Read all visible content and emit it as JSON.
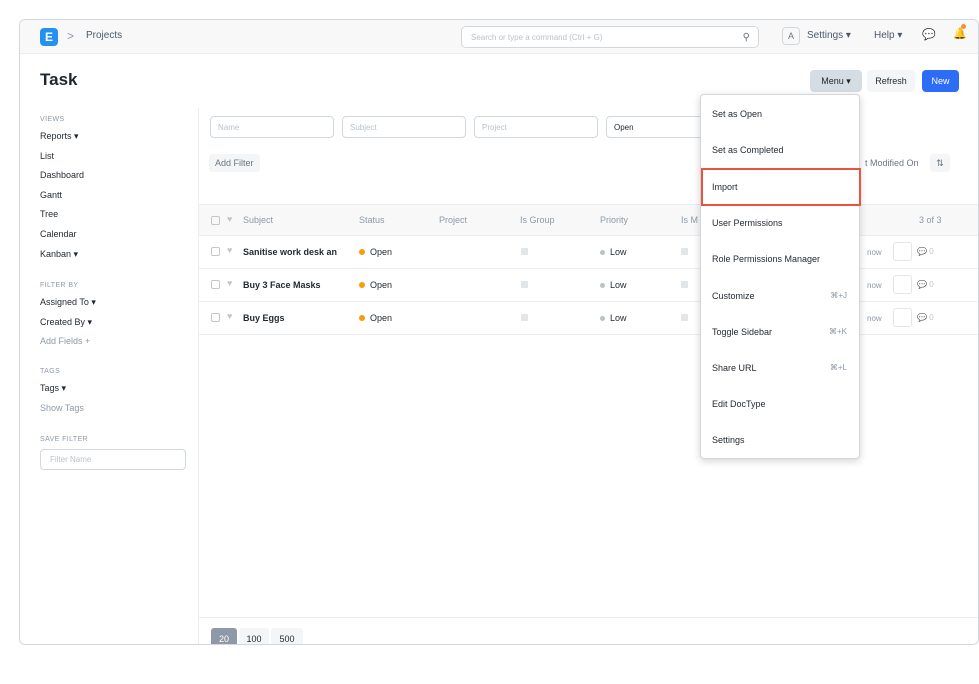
{
  "navbar": {
    "logo_letter": "E",
    "breadcrumb": "Projects",
    "breadcrumb_sep": ">",
    "search_placeholder": "Search or type a command (Ctrl + G)",
    "avatar_letter": "A",
    "settings_label": "Settings ▾",
    "help_label": "Help ▾"
  },
  "page": {
    "title": "Task",
    "menu_label": "Menu ▾",
    "refresh_label": "Refresh",
    "new_label": "New"
  },
  "sidebar": {
    "views_heading": "VIEWS",
    "views": [
      "Reports ▾",
      "List",
      "Dashboard",
      "Gantt",
      "Tree",
      "Calendar",
      "Kanban ▾"
    ],
    "filter_heading": "FILTER BY",
    "filters": [
      "Assigned To ▾",
      "Created By ▾"
    ],
    "add_fields": "Add Fields +",
    "tags_heading": "TAGS",
    "tags": "Tags ▾",
    "show_tags": "Show Tags",
    "save_filter_heading": "SAVE FILTER",
    "filter_name_placeholder": "Filter Name"
  },
  "list": {
    "filters": {
      "name_placeholder": "Name",
      "subject_placeholder": "Subject",
      "project_placeholder": "Project",
      "status_value": "Open"
    },
    "add_filter": "Add Filter",
    "sort_label": "t Modified On",
    "columns": [
      "Subject",
      "Status",
      "Project",
      "Is Group",
      "Priority",
      "Is M"
    ],
    "count": "3 of 3",
    "rows": [
      {
        "subject": "Sanitise work desk an",
        "status": "Open",
        "priority": "Low",
        "modified": "now",
        "comments": "0"
      },
      {
        "subject": "Buy 3 Face Masks",
        "status": "Open",
        "priority": "Low",
        "modified": "now",
        "comments": "0"
      },
      {
        "subject": "Buy Eggs",
        "status": "Open",
        "priority": "Low",
        "modified": "now",
        "comments": "0"
      }
    ],
    "page_sizes": [
      "20",
      "100",
      "500"
    ]
  },
  "menu": {
    "items": [
      {
        "label": "Set as Open",
        "shortcut": ""
      },
      {
        "label": "Set as Completed",
        "shortcut": ""
      },
      {
        "label": "Import",
        "shortcut": ""
      },
      {
        "label": "User Permissions",
        "shortcut": ""
      },
      {
        "label": "Role Permissions Manager",
        "shortcut": ""
      },
      {
        "label": "Customize",
        "shortcut": "⌘+J"
      },
      {
        "label": "Toggle Sidebar",
        "shortcut": "⌘+K"
      },
      {
        "label": "Share URL",
        "shortcut": "⌘+L"
      },
      {
        "label": "Edit DocType",
        "shortcut": ""
      },
      {
        "label": "Settings",
        "shortcut": ""
      }
    ]
  },
  "colors": {
    "primary": "#2d6cf6",
    "highlight": "#e8543c",
    "status_open": "#f59e0b"
  }
}
